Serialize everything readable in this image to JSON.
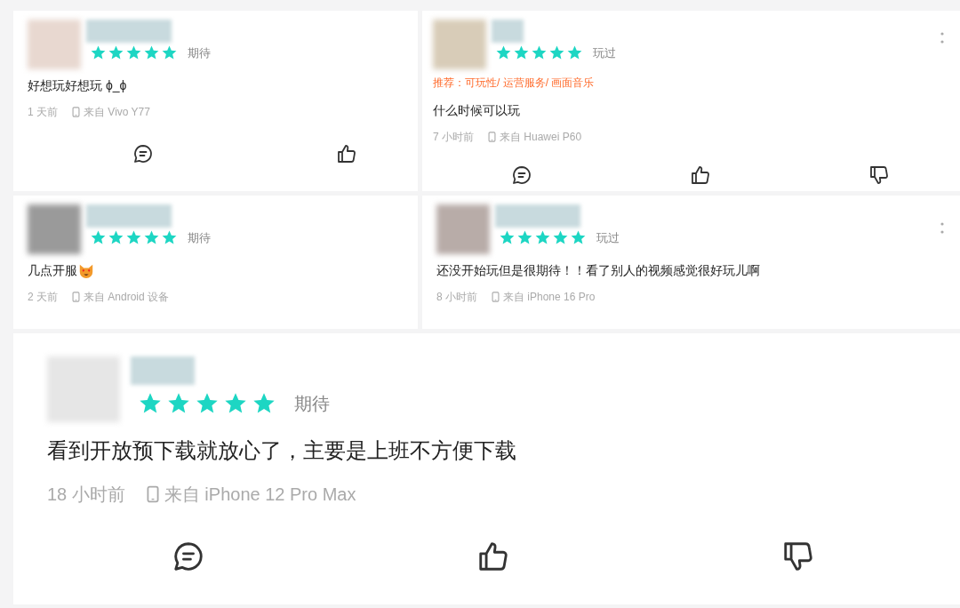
{
  "reviews": [
    {
      "kind": "compact",
      "stars": 5,
      "status": "期待",
      "text": "好想玩好想玩 ϕ_ϕ",
      "time": "1 天前",
      "device": "来自 Vivo Y77",
      "actions": [
        {
          "kind": "comment"
        },
        {
          "kind": "like"
        }
      ]
    },
    {
      "kind": "compact",
      "stars": 5,
      "status": "玩过",
      "recommend": "推荐：可玩性/ 运营服务/ 画面音乐",
      "text": "什么时候可以玩",
      "time": "7 小时前",
      "device": "来自 Huawei P60",
      "actions": [
        {
          "kind": "comment"
        },
        {
          "kind": "like"
        },
        {
          "kind": "dislike"
        }
      ],
      "more": true
    },
    {
      "kind": "compact",
      "stars": 5,
      "status": "期待",
      "text": "几点开服",
      "emoji": true,
      "time": "2 天前",
      "device": "来自 Android 设备"
    },
    {
      "kind": "compact",
      "stars": 5,
      "status": "玩过",
      "text": "还没开始玩但是很期待！！看了别人的视频感觉很好玩儿啊",
      "time": "8 小时前",
      "device": "来自 iPhone 16 Pro",
      "more": true
    },
    {
      "kind": "large",
      "stars": 5,
      "status": "期待",
      "text": "看到开放预下载就放心了，主要是上班不方便下载",
      "time": "18 小时前",
      "device": "来自 iPhone 12 Pro Max",
      "actions": [
        {
          "kind": "comment"
        },
        {
          "kind": "like"
        },
        {
          "kind": "dislike"
        }
      ]
    }
  ]
}
